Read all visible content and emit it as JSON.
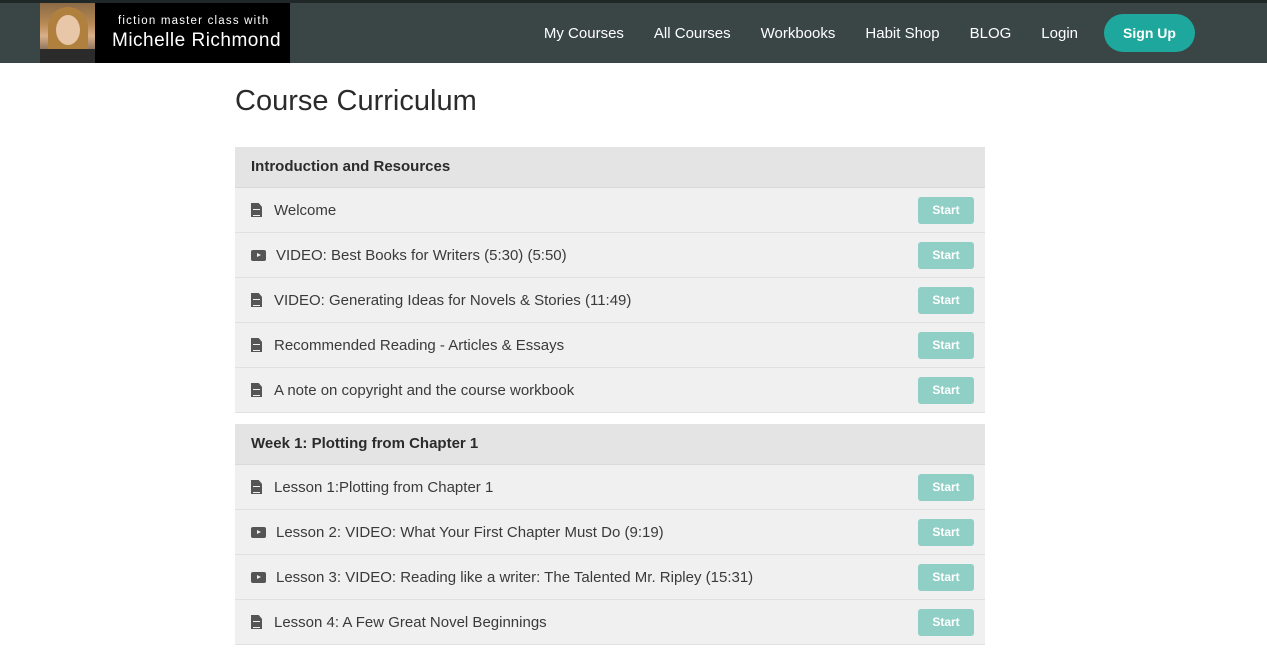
{
  "brand": {
    "subtitle": "fiction master class with",
    "name": "Michelle Richmond"
  },
  "nav": {
    "links": [
      "My Courses",
      "All Courses",
      "Workbooks",
      "Habit Shop",
      "BLOG",
      "Login"
    ],
    "signup": "Sign Up"
  },
  "page": {
    "title": "Course Curriculum"
  },
  "sections": [
    {
      "title": "Introduction and Resources",
      "lectures": [
        {
          "icon": "document-icon",
          "name": "Welcome",
          "action": "Start"
        },
        {
          "icon": "video-icon",
          "name": "VIDEO: Best Books for Writers (5:30) (5:50)",
          "action": "Start"
        },
        {
          "icon": "document-icon",
          "name": "VIDEO: Generating Ideas for Novels & Stories (11:49)",
          "action": "Start"
        },
        {
          "icon": "document-icon",
          "name": "Recommended Reading - Articles & Essays",
          "action": "Start"
        },
        {
          "icon": "document-icon",
          "name": "A note on copyright and the course workbook",
          "action": "Start"
        }
      ]
    },
    {
      "title": "Week 1: Plotting from Chapter 1",
      "lectures": [
        {
          "icon": "document-icon",
          "name": "Lesson 1:Plotting from Chapter 1",
          "action": "Start"
        },
        {
          "icon": "video-icon",
          "name": "Lesson 2: VIDEO: What Your First Chapter Must Do (9:19)",
          "action": "Start"
        },
        {
          "icon": "video-icon",
          "name": "Lesson 3: VIDEO: Reading like a writer: The Talented Mr. Ripley (15:31)",
          "action": "Start"
        },
        {
          "icon": "document-icon",
          "name": "Lesson 4: A Few Great Novel Beginnings",
          "action": "Start"
        }
      ]
    }
  ],
  "colors": {
    "navbar": "#3a4545",
    "accent": "#1ea79c",
    "start_button": "#8fcfc6"
  }
}
